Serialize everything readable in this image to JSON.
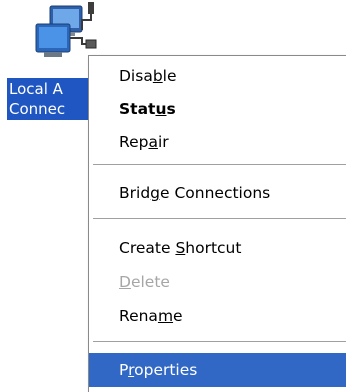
{
  "desktop_icon": {
    "icon": "network-connection-icon",
    "label_line1": "Local A",
    "label_line2": "Connec"
  },
  "context_menu": {
    "items": [
      {
        "pre": "Disa",
        "hotkey": "b",
        "post": "le"
      },
      {
        "pre": "Stat",
        "hotkey": "u",
        "post": "s"
      },
      {
        "pre": "Rep",
        "hotkey": "a",
        "post": "ir"
      },
      {
        "pre": "Brid",
        "hotkey": "g",
        "post": "e Connections"
      },
      {
        "pre": "Create ",
        "hotkey": "S",
        "post": "hortcut"
      },
      {
        "pre": "",
        "hotkey": "D",
        "post": "elete"
      },
      {
        "pre": "Rena",
        "hotkey": "m",
        "post": "e"
      },
      {
        "pre": "P",
        "hotkey": "r",
        "post": "operties"
      }
    ],
    "selected_item": "Properties",
    "default_item": "Status",
    "disabled_item": "Delete"
  },
  "colors": {
    "selection": "#3168c5",
    "label_highlight": "#1f56c1",
    "disabled_text": "#a6a6a6"
  }
}
